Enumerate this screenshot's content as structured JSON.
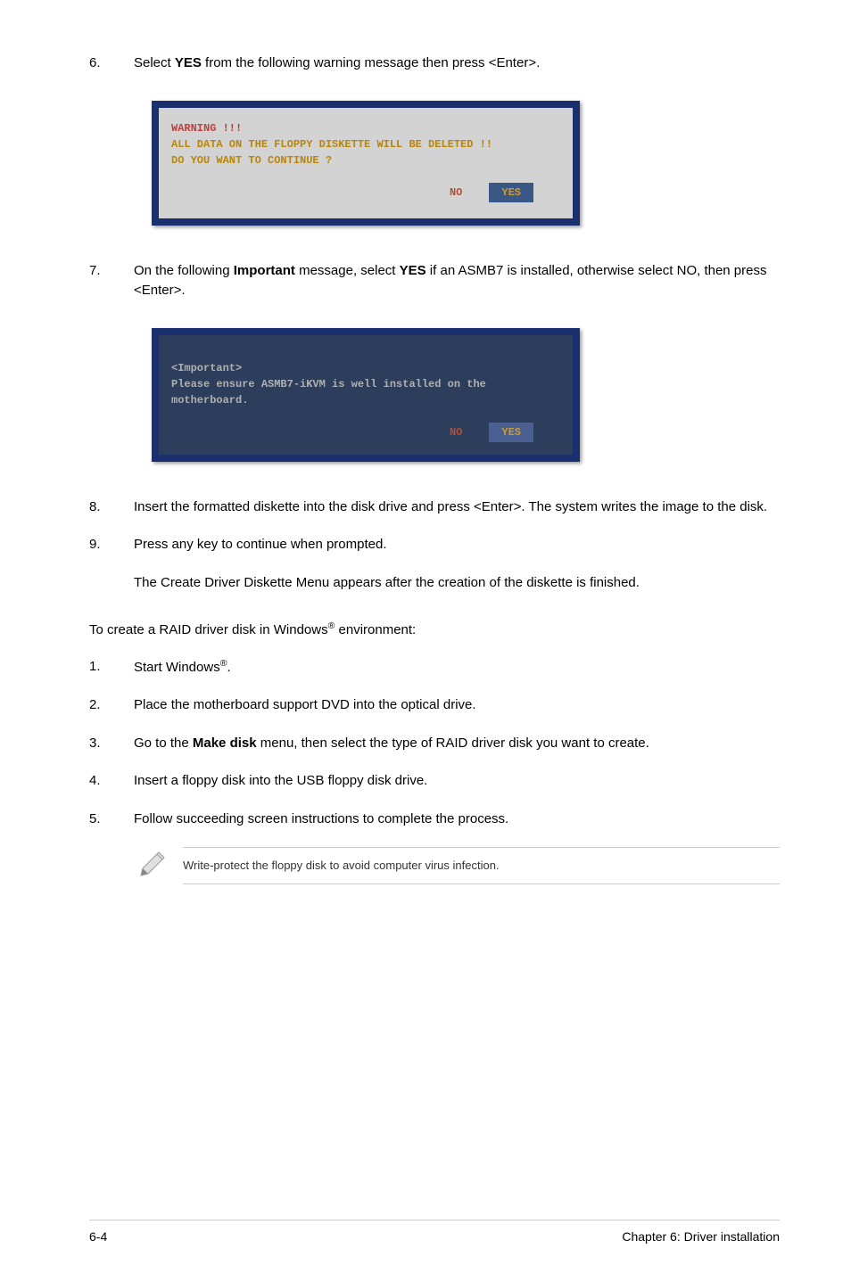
{
  "step6": {
    "num": "6.",
    "text_before": "Select ",
    "yes": "YES",
    "text_after": " from the following warning message then press <Enter>."
  },
  "dialog1": {
    "title": "WARNING !!!",
    "line1": "ALL DATA ON THE FLOPPY DISKETTE WILL BE DELETED !!",
    "line2": "DO YOU WANT TO CONTINUE ?",
    "no": "NO",
    "yes": "YES"
  },
  "step7": {
    "num": "7.",
    "text_before": "On the following ",
    "important": "Important",
    "text_mid": " message, select ",
    "yes": "YES",
    "text_after": " if an ASMB7 is installed, otherwise select NO, then press <Enter>."
  },
  "dialog2": {
    "line1": "<Important>",
    "line2": "Please ensure ASMB7-iKVM is well installed on the",
    "line3": "motherboard.",
    "no": "NO",
    "yes": "YES"
  },
  "step8": {
    "num": "8.",
    "text": "Insert the formatted diskette into the disk drive and press <Enter>. The system writes the image to the disk."
  },
  "step9": {
    "num": "9.",
    "text": "Press any key to continue when prompted.",
    "subtext": "The Create Driver Diskette Menu appears after the creation of the diskette is finished."
  },
  "section2_intro_before": "To create a RAID driver disk in Windows",
  "section2_intro_after": " environment:",
  "reg": "®",
  "s1": {
    "num": "1.",
    "before": "Start Windows",
    "after": "."
  },
  "s2": {
    "num": "2.",
    "text": "Place the motherboard support DVD into the optical drive."
  },
  "s3": {
    "num": "3.",
    "before": "Go to the ",
    "bold": "Make disk",
    "after": " menu, then select the type of RAID driver disk you want to create."
  },
  "s4": {
    "num": "4.",
    "text": "Insert a floppy disk into the USB floppy disk drive."
  },
  "s5": {
    "num": "5.",
    "text": "Follow succeeding screen instructions to complete the process."
  },
  "note": "Write-protect the floppy disk to avoid computer virus infection.",
  "footer": {
    "left": "6-4",
    "right": "Chapter 6: Driver installation"
  }
}
